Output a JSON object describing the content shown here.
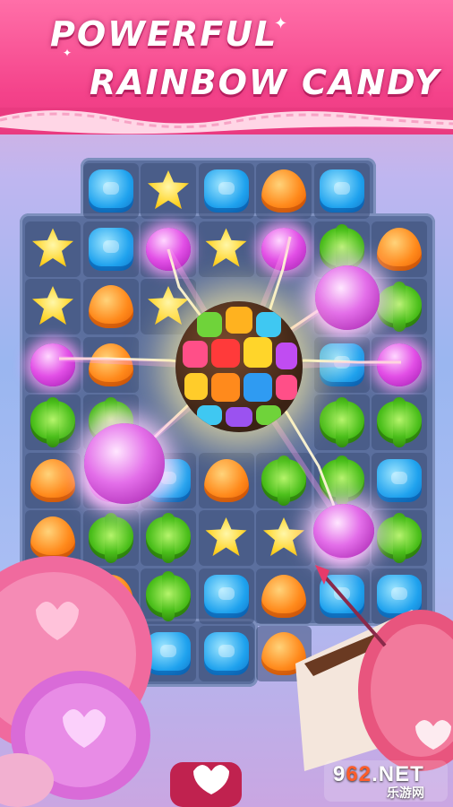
{
  "title": {
    "line1": "POWERFUL",
    "line2": "RAINBOW CANDY"
  },
  "board": {
    "rows": [
      [
        "",
        "blue",
        "yellow",
        "blue",
        "orange",
        "blue",
        ""
      ],
      [
        "yellow",
        "blue",
        "purple",
        "yellow",
        "purple",
        "green",
        "orange"
      ],
      [
        "yellow",
        "orange",
        "yellow",
        "",
        "",
        "purple",
        "green"
      ],
      [
        "purple",
        "orange",
        "",
        "",
        "",
        "blue",
        "purple"
      ],
      [
        "green",
        "green",
        "",
        "",
        "",
        "green",
        "green"
      ],
      [
        "orange",
        "purple",
        "blue",
        "orange",
        "green",
        "green",
        "blue"
      ],
      [
        "orange",
        "green",
        "green",
        "yellow",
        "yellow",
        "purple",
        "green"
      ],
      [
        "",
        "orange",
        "green",
        "blue",
        "orange",
        "blue",
        "blue"
      ],
      [
        "",
        "",
        "blue",
        "blue",
        "orange",
        "",
        ""
      ]
    ]
  },
  "power_up": {
    "name": "rainbow-candy-ball"
  },
  "watermark": {
    "main_prefix": "9",
    "main_accent": "62",
    "main_suffix": ".NET",
    "sub": "乐游网"
  },
  "colors": {
    "banner": "#f4428a",
    "blue_candy": "#1fa2ee",
    "orange_candy": "#ff8a1c",
    "yellow_candy": "#ffd428",
    "green_candy": "#4bbf1b",
    "purple_candy": "#e24fe6"
  }
}
